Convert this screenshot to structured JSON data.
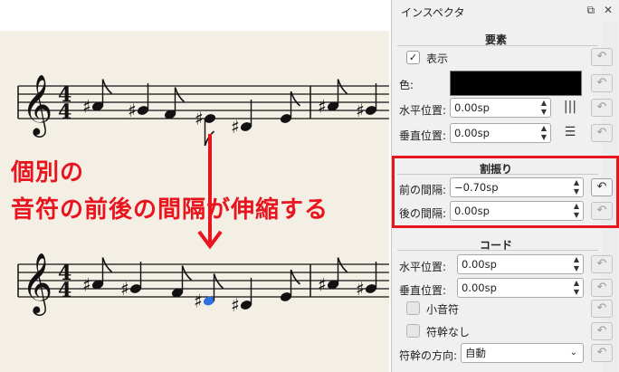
{
  "callout": {
    "line1": "個別の",
    "line2": "音符の前後の間隔が伸縮する"
  },
  "inspector": {
    "title": "インスペクタ",
    "title_icons": {
      "float": "⧉",
      "close": "✕"
    },
    "element": {
      "section_title": "要素",
      "visible_label": "表示",
      "visible_checked": true,
      "color_label": "色:",
      "color_value": "#000000",
      "h_offset_label": "水平位置:",
      "h_offset_value": "0.00sp",
      "v_offset_label": "垂直位置:",
      "v_offset_value": "0.00sp"
    },
    "segment": {
      "section_title": "割振り",
      "leading_label": "前の間隔:",
      "leading_value": "−0.70sp",
      "trailing_label": "後の間隔:",
      "trailing_value": "0.00sp"
    },
    "chord": {
      "section_title": "コード",
      "h_offset_label": "水平位置:",
      "h_offset_value": "0.00sp",
      "v_offset_label": "垂直位置:",
      "v_offset_value": "0.00sp",
      "small_label": "小音符",
      "no_stem_label": "符幹なし",
      "stem_dir_label": "符幹の方向:",
      "stem_dir_value": "自動"
    },
    "reset_glyph": "↶",
    "spin_up": "▲",
    "spin_down": "▼",
    "chevron": "⌄",
    "check": "✓"
  },
  "score": {
    "time_sig_top": "4",
    "time_sig_bottom": "4",
    "clef": "𝄞",
    "sharp": "♯",
    "down_arrow": "↓"
  },
  "colors": {
    "callout": "#e8141e",
    "selected_note": "#2f6fe0",
    "paper": "#f3efe4"
  }
}
